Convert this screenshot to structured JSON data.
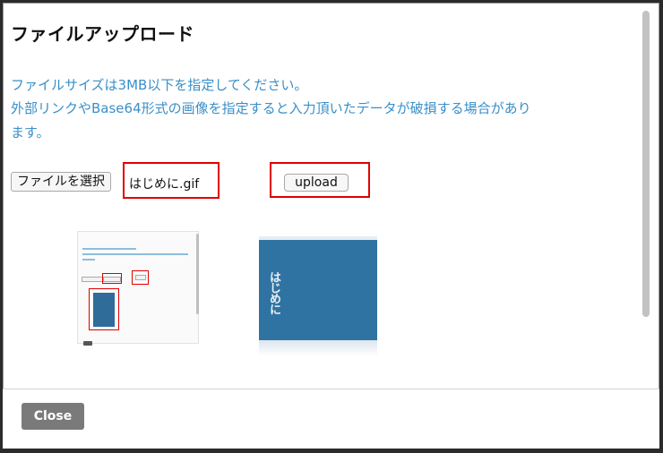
{
  "dialog": {
    "title": "ファイルアップロード",
    "notes": [
      "ファイルサイズは3MB以下を指定してください。",
      "外部リンクやBase64形式の画像を指定すると入力頂いたデータが破損する場合があり",
      "ます。"
    ]
  },
  "file_input": {
    "button_label": "ファイルを選択",
    "file_name": "はじめに.gif"
  },
  "upload_button": {
    "label": "upload"
  },
  "preview": {
    "text": "はじめに"
  },
  "footer": {
    "close_label": "Close"
  },
  "colors": {
    "note_text": "#3a8fc8",
    "highlight": "#e00000",
    "preview_bg": "#2f73a3",
    "close_bg": "#7a7a7a"
  }
}
